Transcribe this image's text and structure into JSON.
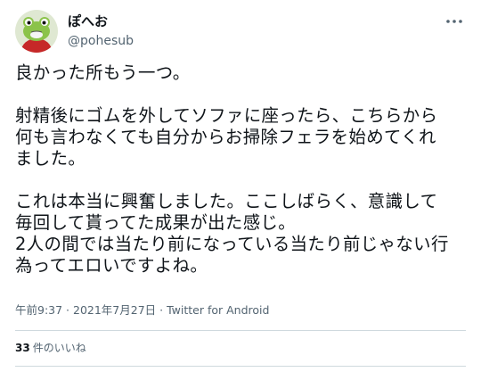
{
  "author": {
    "display_name": "ぽへお",
    "handle": "@pohesub"
  },
  "tweet": {
    "text": "良かった所もう一つ。\n\n射精後にゴムを外してソファに座ったら、こちらから\n何も言わなくても自分からお掃除フェラを始めてくれ\nました。\n\nこれは本当に興奮しました。ここしばらく、意識して\n毎回して貰ってた成果が出た感じ。\n2人の間では当たり前になっている当たり前じゃない行\n為ってエロいですよね。"
  },
  "meta": {
    "time": "午前9:37",
    "separator1": " · ",
    "date": "2021年7月27日",
    "separator2": " · ",
    "source": "Twitter for Android"
  },
  "stats": {
    "likes_count": "33",
    "likes_label": "件のいいね"
  },
  "icons": {
    "avatar": "frog-avatar",
    "more": "more-dots-icon"
  },
  "colors": {
    "text": "#0f1419",
    "secondary": "#536471",
    "divider": "#cfd9de"
  }
}
